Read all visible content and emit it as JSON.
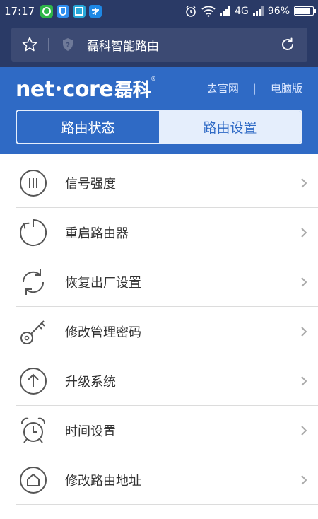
{
  "status_bar": {
    "time": "17:17",
    "network": "4G",
    "battery": "96%",
    "battery_level": 0.96,
    "app_icons": [
      "green-app-icon",
      "blue-shield-app-icon",
      "teal-scan-app-icon",
      "blue-alipay-app-icon"
    ]
  },
  "browser": {
    "url_title": "磊科智能路由"
  },
  "header": {
    "logo_text": "net",
    "logo_text2": "core",
    "logo_cn": "磊科",
    "logo_mark": "®",
    "link_official": "去官网",
    "link_separator": "|",
    "link_pc": "电脑版",
    "tabs": [
      {
        "label": "路由状态",
        "active": true
      },
      {
        "label": "路由设置",
        "active": false
      }
    ]
  },
  "menu": {
    "items": [
      {
        "label": "信号强度",
        "icon": "signal-strength-icon"
      },
      {
        "label": "重启路由器",
        "icon": "restart-icon"
      },
      {
        "label": "恢复出厂设置",
        "icon": "factory-reset-icon"
      },
      {
        "label": "修改管理密码",
        "icon": "key-icon"
      },
      {
        "label": "升级系统",
        "icon": "upgrade-icon"
      },
      {
        "label": "时间设置",
        "icon": "alarm-clock-icon"
      },
      {
        "label": "修改路由地址",
        "icon": "home-address-icon"
      }
    ]
  },
  "colors": {
    "status_bg": "#2a3a66",
    "header_bg": "#2f6ac5",
    "tab_inactive_bg": "#e5eefc",
    "icon_stroke": "#555555"
  }
}
